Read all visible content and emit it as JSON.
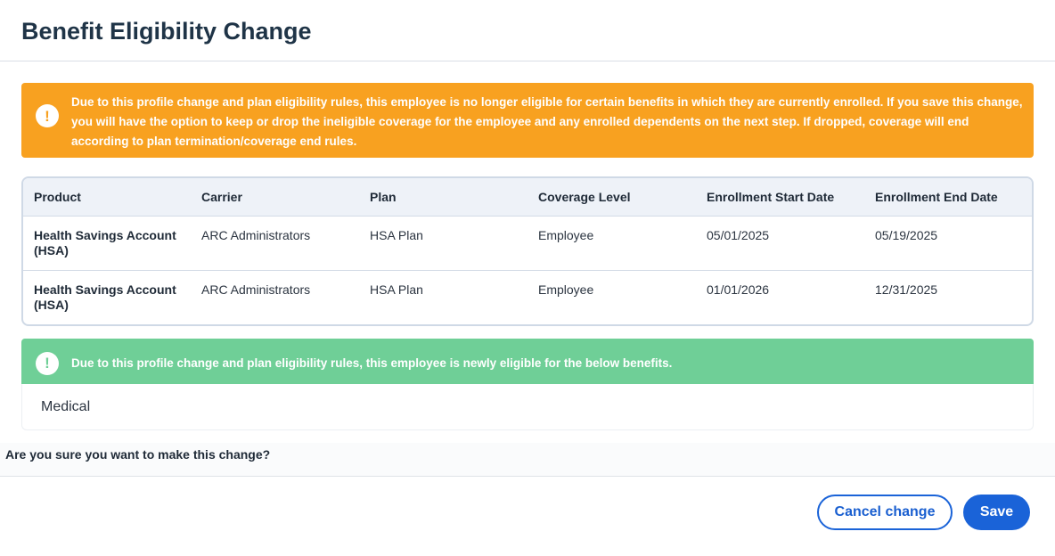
{
  "page": {
    "title": "Benefit Eligibility Change"
  },
  "alerts": {
    "ineligible": {
      "icon": "exclamation-circle-icon",
      "color": "#f8a120",
      "text": "Due to this profile change and plan eligibility rules, this employee is no longer eligible for certain benefits in which they are currently enrolled. If you save this change, you will have the option to keep or drop the ineligible coverage for the employee and any enrolled dependents on the next step. If dropped, coverage will end according to plan termination/coverage end rules."
    },
    "eligible": {
      "icon": "exclamation-circle-icon",
      "color": "#6fcf97",
      "text": "Due to this profile change and plan eligibility rules, this employee is newly eligible for the below benefits."
    }
  },
  "table": {
    "columns": [
      "Product",
      "Carrier",
      "Plan",
      "Coverage Level",
      "Enrollment Start Date",
      "Enrollment End Date"
    ],
    "rows": [
      {
        "product": "Health Savings Account (HSA)",
        "carrier": "ARC Administrators",
        "plan": "HSA Plan",
        "coverage": "Employee",
        "start": "05/01/2025",
        "end": "05/19/2025"
      },
      {
        "product": "Health Savings Account (HSA)",
        "carrier": "ARC Administrators",
        "plan": "HSA Plan",
        "coverage": "Employee",
        "start": "01/01/2026",
        "end": "12/31/2025"
      }
    ]
  },
  "new_benefits": [
    "Medical"
  ],
  "confirm": {
    "question": "Are you sure you want to make this change?"
  },
  "buttons": {
    "cancel": "Cancel change",
    "save": "Save"
  },
  "colors": {
    "primary": "#1a63d8",
    "warning": "#f8a120",
    "success": "#6fcf97",
    "title": "#1f3447"
  }
}
